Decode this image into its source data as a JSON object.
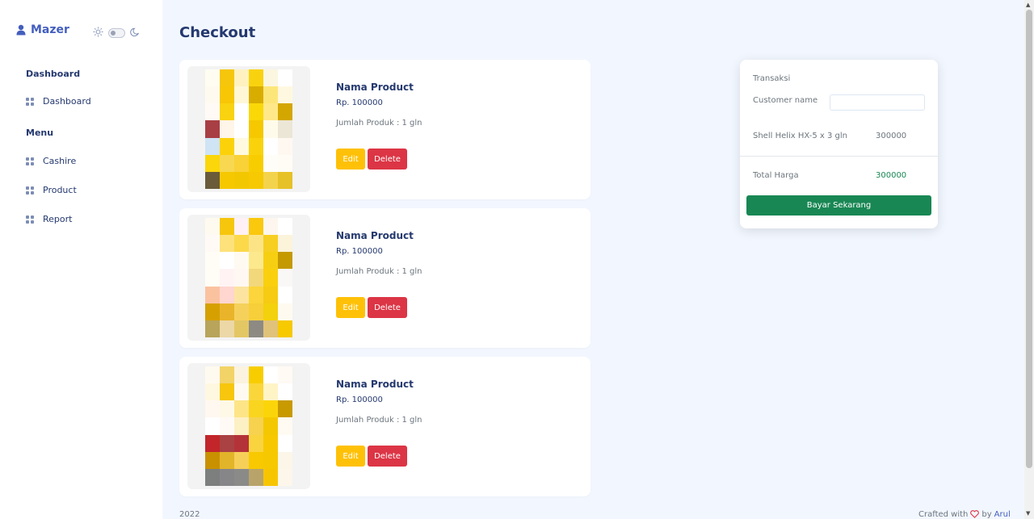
{
  "brand": {
    "name": "Mazer"
  },
  "sidebar": {
    "sections": [
      {
        "title": "Dashboard",
        "items": [
          {
            "label": "Dashboard"
          }
        ]
      },
      {
        "title": "Menu",
        "items": [
          {
            "label": "Cashire"
          },
          {
            "label": "Product"
          },
          {
            "label": "Report"
          }
        ]
      }
    ]
  },
  "page": {
    "title": "Checkout"
  },
  "products": [
    {
      "name": "Nama Product",
      "price": "Rp. 100000",
      "qty": "Jumlah Produk : 1 gln",
      "edit_label": "Edit",
      "delete_label": "Delete"
    },
    {
      "name": "Nama Product",
      "price": "Rp. 100000",
      "qty": "Jumlah Produk : 1 gln",
      "edit_label": "Edit",
      "delete_label": "Delete"
    },
    {
      "name": "Nama Product",
      "price": "Rp. 100000",
      "qty": "Jumlah Produk : 1 gln",
      "edit_label": "Edit",
      "delete_label": "Delete"
    }
  ],
  "transaction": {
    "title": "Transaksi",
    "customer_label": "Customer name",
    "customer_value": "",
    "item_name": "Shell Helix HX-5 x 3 gln",
    "item_price": "300000",
    "total_label": "Total Harga",
    "total_value": "300000",
    "pay_label": "Bayar Sekarang"
  },
  "footer": {
    "year": "2022",
    "crafted": "Crafted with",
    "by": "by",
    "author": "Arul"
  },
  "colors": {
    "primary": "#435ebe",
    "warning": "#ffc107",
    "danger": "#dc3545",
    "success": "#198754",
    "background": "#f2f7ff"
  }
}
